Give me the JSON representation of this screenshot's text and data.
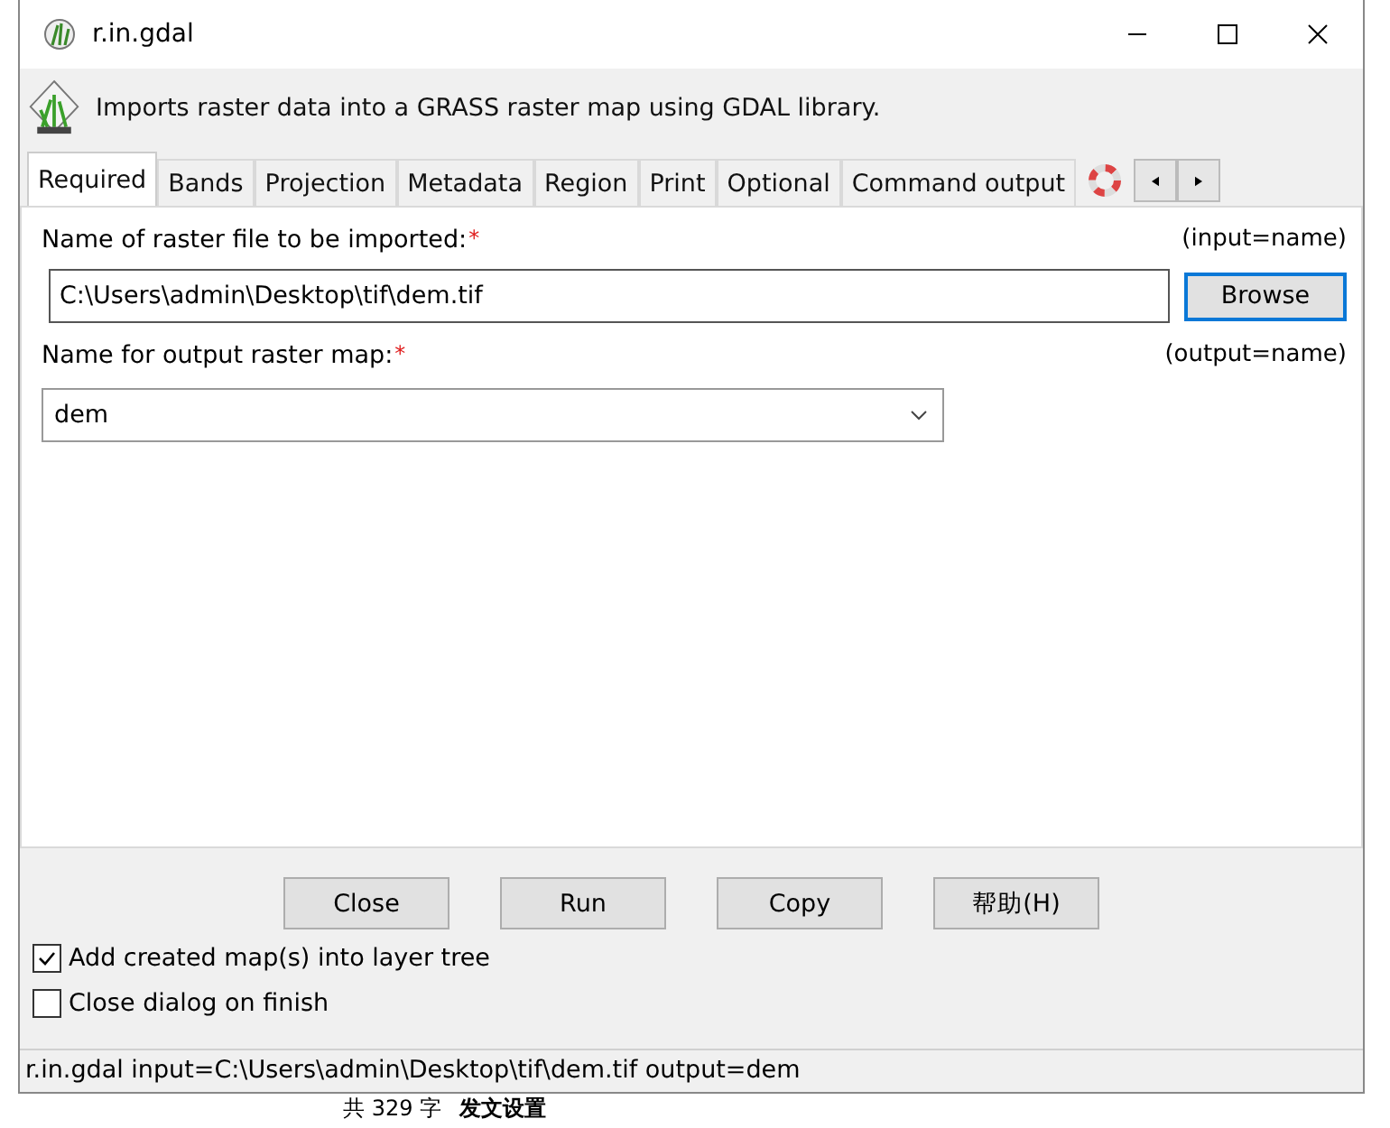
{
  "window": {
    "title": "r.in.gdal"
  },
  "description": "Imports raster data into a GRASS raster map using GDAL library.",
  "tabs": [
    {
      "label": "Required",
      "selected": true
    },
    {
      "label": "Bands",
      "selected": false
    },
    {
      "label": "Projection",
      "selected": false
    },
    {
      "label": "Metadata",
      "selected": false
    },
    {
      "label": "Region",
      "selected": false
    },
    {
      "label": "Print",
      "selected": false
    },
    {
      "label": "Optional",
      "selected": false
    },
    {
      "label": "Command output",
      "selected": false
    }
  ],
  "fields": [
    {
      "kind": "file",
      "label": "Name of raster file to be imported:",
      "required_mark": "*",
      "key": "(input=name)",
      "value": "C:\\Users\\admin\\Desktop\\tif\\dem.tif",
      "button": "Browse"
    },
    {
      "kind": "select",
      "label": "Name for output raster map:",
      "required_mark": "*",
      "key": "(output=name)",
      "value": "dem"
    }
  ],
  "buttons": [
    "Close",
    "Run",
    "Copy",
    "帮助(H)"
  ],
  "options": [
    {
      "label": "Add created map(s) into layer tree",
      "checked": true
    },
    {
      "label": "Close dialog on finish",
      "checked": false
    }
  ],
  "status_bar": "r.in.gdal input=C:\\Users\\admin\\Desktop\\tif\\dem.tif output=dem",
  "background": {
    "word_count": "共 329 字",
    "settings": "发文设置"
  }
}
